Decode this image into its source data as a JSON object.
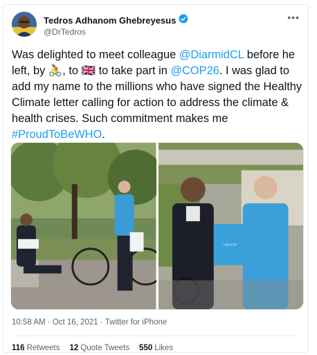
{
  "author": {
    "display_name": "Tedros Adhanom Ghebreyesus",
    "handle": "@DrTedros",
    "verified_icon": "verified-badge-icon"
  },
  "more_icon": "more-options-icon",
  "tweet": {
    "t1": "Was delighted to meet colleague ",
    "mention1": "@DiarmidCL",
    "t2": " before he left, by ",
    "emoji_bike": "🚴",
    "t3": ", to ",
    "emoji_flag": "🇬🇧",
    "t4": " to take part in ",
    "hashtag_cop": "@COP26",
    "t5": ". I was glad to add my name to the millions who have signed the Healthy Climate letter calling for action to address the climate & health crises. Such commitment makes me ",
    "hashtag_who": "#ProudToBeWHO",
    "t6": "."
  },
  "media": {
    "photo1_alt": "photo-two-men-park",
    "photo2_alt": "photo-two-men-holding-book",
    "book_text": "THE HEALTH ARGUMENT FOR CLIMATE ACTION"
  },
  "meta": {
    "time": "10:58 AM",
    "date": "Oct 16, 2021",
    "source": "Twitter for iPhone"
  },
  "stats": {
    "retweets_count": "116",
    "retweets_label": "Retweets",
    "quotes_count": "12",
    "quotes_label": "Quote Tweets",
    "likes_count": "550",
    "likes_label": "Likes"
  },
  "colors": {
    "link": "#1d9bf0",
    "text": "#0f1419",
    "secondary": "#536471",
    "border": "#e6ecf0"
  }
}
